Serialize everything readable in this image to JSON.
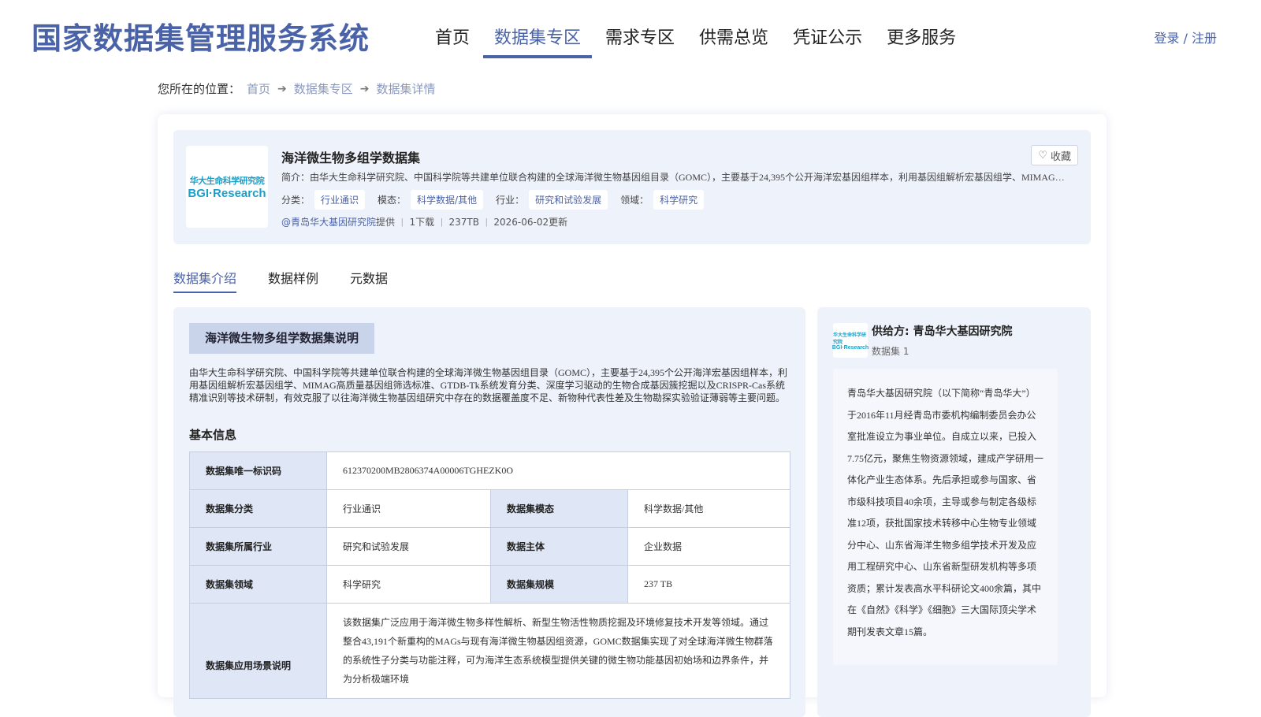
{
  "header": {
    "site_title": "国家数据集管理服务系统",
    "nav": [
      "首页",
      "数据集专区",
      "需求专区",
      "供需总览",
      "凭证公示",
      "更多服务"
    ],
    "active_nav": 1,
    "login": "登录 / 注册"
  },
  "breadcrumb": {
    "lead": "您所在的位置：",
    "items": [
      "首页",
      "数据集专区",
      "数据集详情"
    ]
  },
  "dataset": {
    "logo_cn": "华大生命科学研究院",
    "logo_en": "BGI·Research",
    "title": "海洋微生物多组学数据集",
    "favorite": "收藏",
    "intro": "简介：由华大生命科学研究院、中国科学院等共建单位联合构建的全球海洋微生物基因组目录（GOMC），主要基于24,395个公开海洋宏基因组样本，利用基因组解析宏基因组学、MIMAG高质量基因组筛选标准、GTDB-Tk系统发育分类、深度学习驱动的生物合成基因簇挖掘以及CRISPR-Cas系统精准识别等技术研制",
    "tags": [
      {
        "label": "分类：",
        "value": "行业通识"
      },
      {
        "label": "模态：",
        "value": "科学数据/其他"
      },
      {
        "label": "行业：",
        "value": "研究和试验发展"
      },
      {
        "label": "领域：",
        "value": "科学研究"
      }
    ],
    "provider_link": "@青岛华大基因研究院",
    "provided": "提供",
    "downloads": "1下载",
    "size": "237TB",
    "updated": "2026-06-02更新"
  },
  "tabs": [
    "数据集介绍",
    "数据样例",
    "元数据"
  ],
  "description": {
    "section_title": "海洋微生物多组学数据集说明",
    "text": "由华大生命科学研究院、中国科学院等共建单位联合构建的全球海洋微生物基因组目录（GOMC），主要基于24,395个公开海洋宏基因组样本，利用基因组解析宏基因组学、MIMAG高质量基因组筛选标准、GTDB-Tk系统发育分类、深度学习驱动的生物合成基因簇挖掘以及CRISPR-Cas系统精准识别等技术研制，有效克服了以往海洋微生物基因组研究中存在的数据覆盖度不足、新物种代表性差及生物勘探实验验证薄弱等主要问题。"
  },
  "basic_info": {
    "title": "基本信息",
    "uid_label": "数据集唯一标识码",
    "uid_value": "612370200MB2806374A00006TGHEZK0O",
    "category_label": "数据集分类",
    "category_value": "行业通识",
    "modality_label": "数据集模态",
    "modality_value": "科学数据/其他",
    "industry_label": "数据集所属行业",
    "industry_value": "研究和试验发展",
    "subject_label": "数据主体",
    "subject_value": "企业数据",
    "domain_label": "数据集领域",
    "domain_value": "科学研究",
    "scale_label": "数据集规模",
    "scale_value": "237 TB",
    "scenario_label": "数据集应用场景说明",
    "scenario_value": "该数据集广泛应用于海洋微生物多样性解析、新型生物活性物质挖掘及环境修复技术开发等领域。通过整合43,191个新重构的MAGs与现有海洋微生物基因组资源，GOMC数据集实现了对全球海洋微生物群落的系统性子分类与功能注释，可为海洋生态系统模型提供关键的微生物功能基因初始场和边界条件，并为分析极端环境"
  },
  "provider": {
    "logo_cn": "华大生命科学研究院",
    "logo_en": "BGI·Research",
    "name": "供给方: 青岛华大基因研究院",
    "count": "数据集 1",
    "desc": "青岛华大基因研究院（以下简称“青岛华大”）于2016年11月经青岛市委机构编制委员会办公室批准设立为事业单位。自成立以来，已投入7.75亿元，聚焦生物资源领域，建成产学研用一体化产业生态体系。先后承担或参与国家、省市级科技项目40余项，主导或参与制定各级标准12项，获批国家技术转移中心生物专业领域分中心、山东省海洋生物多组学技术开发及应用工程研究中心、山东省新型研发机构等多项资质；累计发表高水平科研论文400余篇，其中在《自然》《科学》《细胞》三大国际顶尖学术期刊发表文章15篇。"
  }
}
